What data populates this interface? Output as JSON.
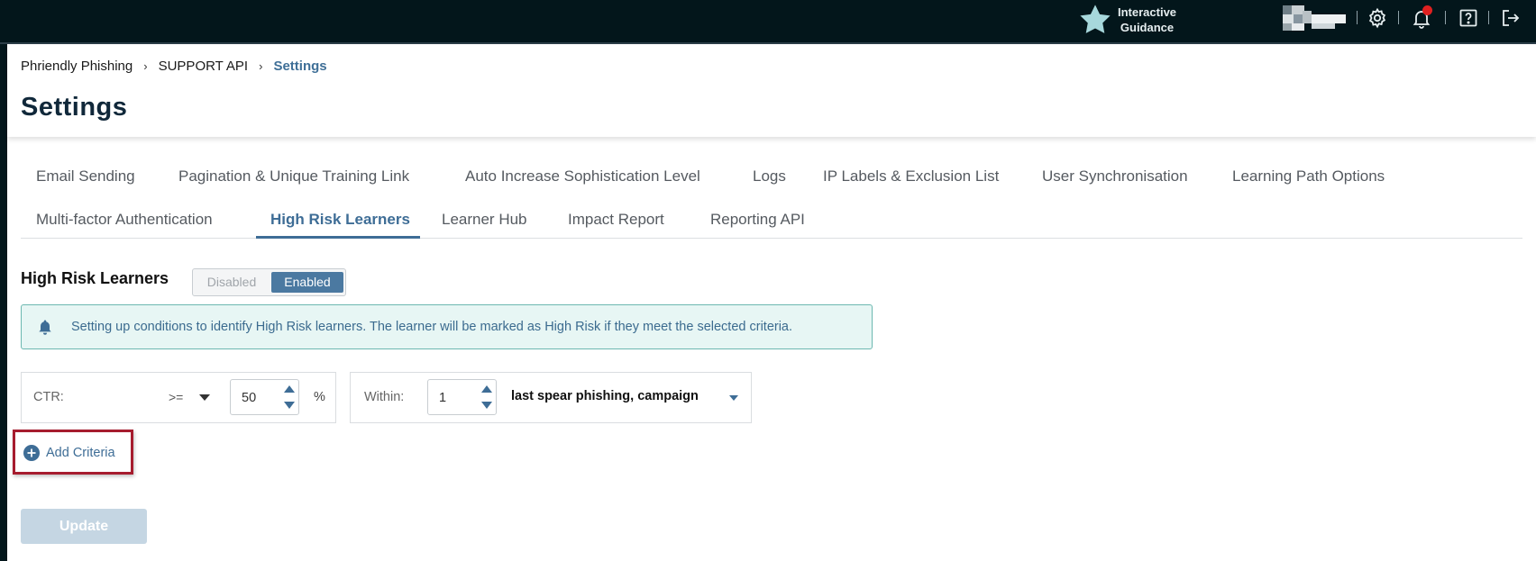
{
  "topbar": {
    "guidance_line1": "Interactive",
    "guidance_line2": "Guidance",
    "icons": [
      "star-icon",
      "avatar",
      "gear-icon",
      "bell-icon",
      "help-icon",
      "logout-icon"
    ],
    "notification_dot_color": "#e02020"
  },
  "breadcrumb": {
    "items": [
      "Phriendly Phishing",
      "SUPPORT API",
      "Settings"
    ],
    "separator": "›"
  },
  "page": {
    "title": "Settings"
  },
  "tabs": [
    {
      "label": "Email Sending",
      "active": false
    },
    {
      "label": "Pagination & Unique Training Link",
      "active": false
    },
    {
      "label": "Auto Increase Sophistication Level",
      "active": false
    },
    {
      "label": "Logs",
      "active": false
    },
    {
      "label": "IP Labels & Exclusion List",
      "active": false
    },
    {
      "label": "User Synchronisation",
      "active": false
    },
    {
      "label": "Learning Path Options",
      "active": false
    },
    {
      "label": "Multi-factor Authentication",
      "active": false
    },
    {
      "label": "High Risk Learners",
      "active": true
    },
    {
      "label": "Learner Hub",
      "active": false
    },
    {
      "label": "Impact Report",
      "active": false
    },
    {
      "label": "Reporting API",
      "active": false
    }
  ],
  "section": {
    "title": "High Risk Learners",
    "toggle": {
      "off_label": "Disabled",
      "on_label": "Enabled",
      "selected": "Enabled"
    },
    "alert_text": "Setting up conditions to identify High Risk learners. The learner will be marked as High Risk if they meet the selected criteria."
  },
  "criteria": {
    "metric_label": "CTR:",
    "operator": ">=",
    "threshold": "50",
    "unit": "%",
    "within_label": "Within:",
    "within_count": "1",
    "within_scope": "last spear phishing, campaign"
  },
  "actions": {
    "add_criteria_label": "Add Criteria",
    "update_label": "Update"
  },
  "colors": {
    "topbar_bg": "#03161b",
    "accent": "#3e6d96",
    "alert_bg": "#e7f6f4",
    "highlight_border": "#a61c2e",
    "update_disabled_bg": "#c5d6e3"
  }
}
